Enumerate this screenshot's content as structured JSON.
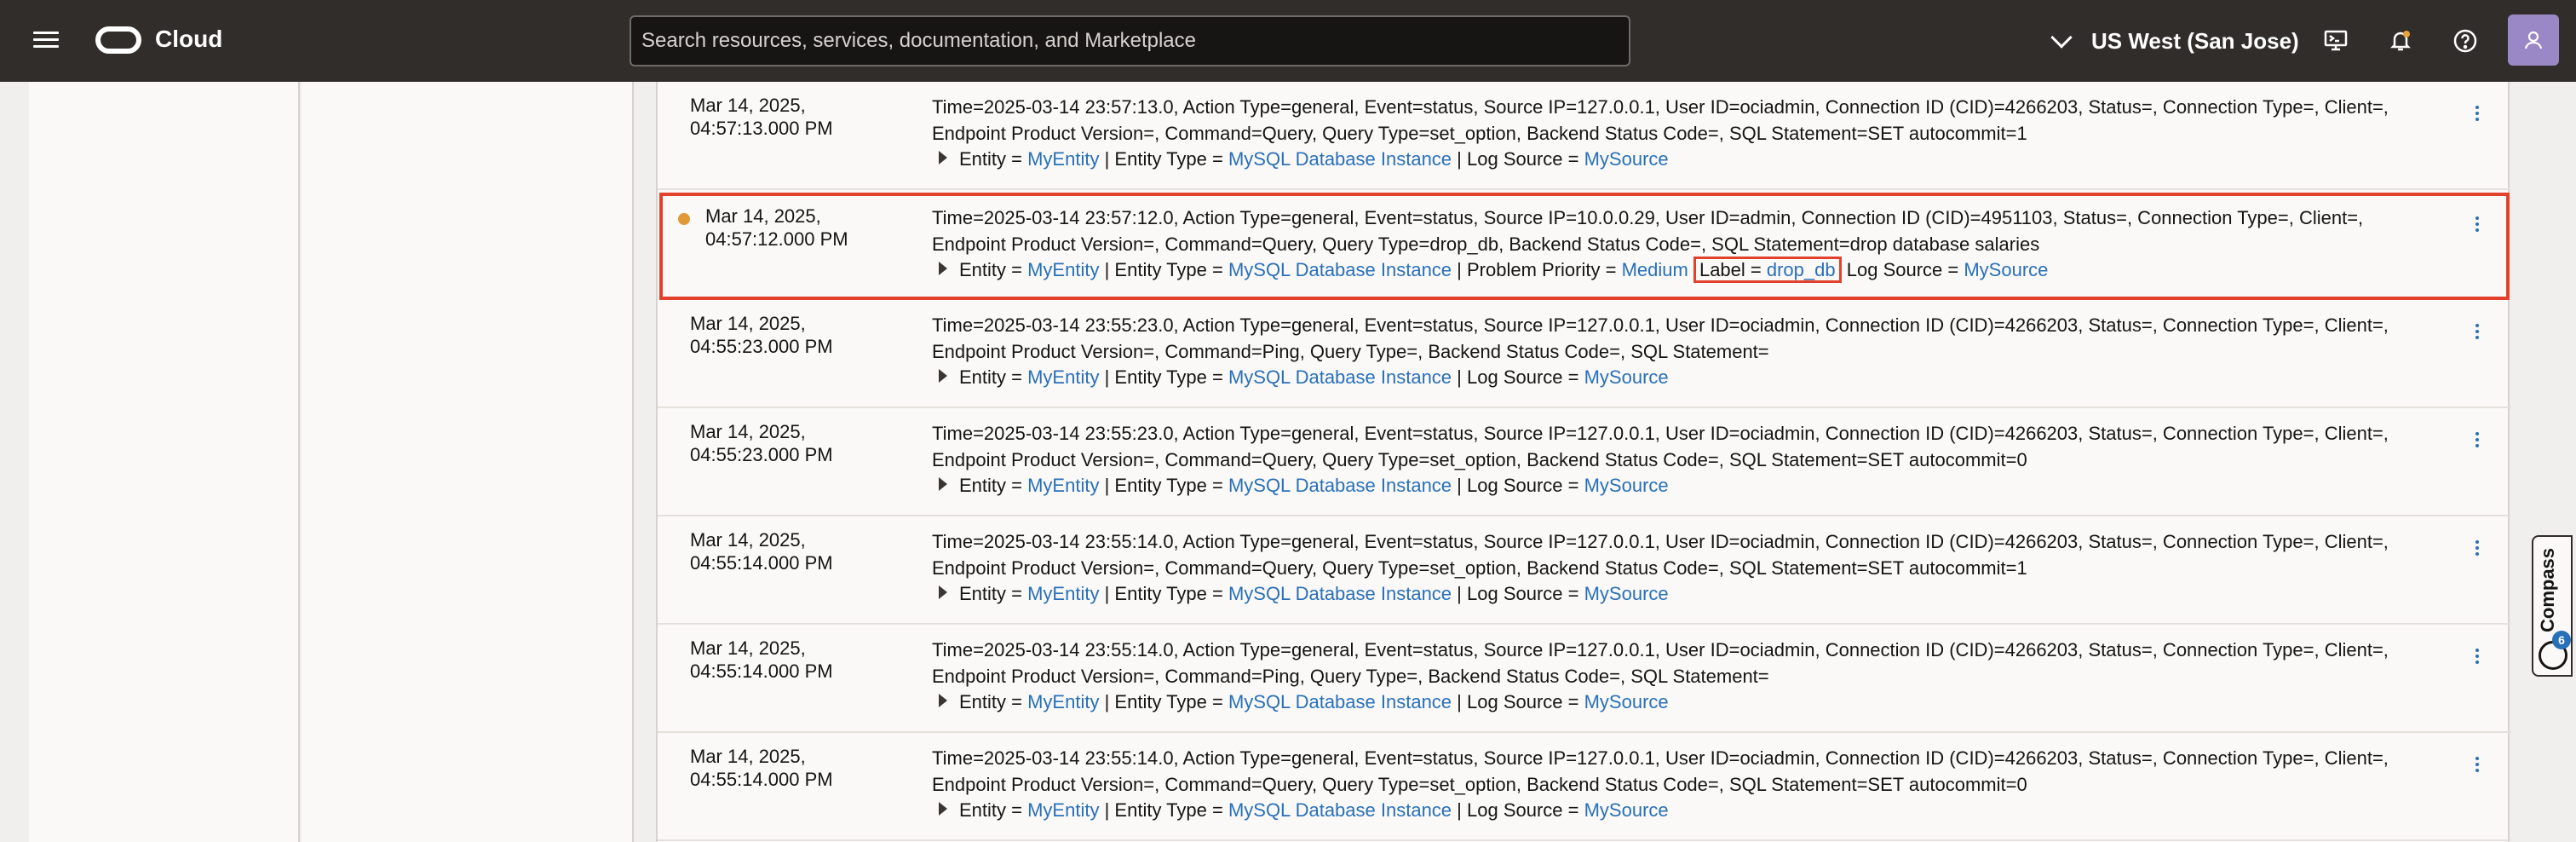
{
  "header": {
    "brand": "Cloud",
    "search_placeholder": "Search resources, services, documentation, and Marketplace",
    "region": "US West (San Jose)"
  },
  "compass": {
    "label": "Compass",
    "badge": "6"
  },
  "rows": [
    {
      "date": "Mar 14, 2025,",
      "time": "04:57:13.000 PM",
      "msg": "Time=2025-03-14 23:57:13.0, Action Type=general, Event=status, Source IP=127.0.0.1, User ID=ociadmin, Connection ID (CID)=4266203, Status=, Connection Type=, Client=, Endpoint Product Version=, Command=Query, Query Type=set_option, Backend Status Code=, SQL Statement=SET autocommit=1",
      "entity_key": "Entity =",
      "entity": "MyEntity",
      "sep1": "| Entity Type =",
      "entity_type": "MySQL Database Instance",
      "sep2": "| Log Source =",
      "log_source": "MySource"
    },
    {
      "date": "Mar 14, 2025,",
      "time": "04:57:12.000 PM",
      "msg": "Time=2025-03-14 23:57:12.0, Action Type=general, Event=status, Source IP=10.0.0.29, User ID=admin, Connection ID (CID)=4951103, Status=, Connection Type=, Client=, Endpoint Product Version=, Command=Query, Query Type=drop_db, Backend Status Code=, SQL Statement=drop database salaries",
      "entity_key": "Entity =",
      "entity": "MyEntity",
      "sep1": "| Entity Type =",
      "entity_type": "MySQL Database Instance",
      "priority_key": "| Problem Priority =",
      "priority": "Medium",
      "label_key": "Label =",
      "label": "drop_db",
      "sep2": "Log Source =",
      "log_source": "MySource"
    },
    {
      "date": "Mar 14, 2025,",
      "time": "04:55:23.000 PM",
      "msg": "Time=2025-03-14 23:55:23.0, Action Type=general, Event=status, Source IP=127.0.0.1, User ID=ociadmin, Connection ID (CID)=4266203, Status=, Connection Type=, Client=, Endpoint Product Version=, Command=Ping, Query Type=, Backend Status Code=, SQL Statement=",
      "entity_key": "Entity =",
      "entity": "MyEntity",
      "sep1": "| Entity Type =",
      "entity_type": "MySQL Database Instance",
      "sep2": "| Log Source =",
      "log_source": "MySource"
    },
    {
      "date": "Mar 14, 2025,",
      "time": "04:55:23.000 PM",
      "msg": "Time=2025-03-14 23:55:23.0, Action Type=general, Event=status, Source IP=127.0.0.1, User ID=ociadmin, Connection ID (CID)=4266203, Status=, Connection Type=, Client=, Endpoint Product Version=, Command=Query, Query Type=set_option, Backend Status Code=, SQL Statement=SET autocommit=0",
      "entity_key": "Entity =",
      "entity": "MyEntity",
      "sep1": "| Entity Type =",
      "entity_type": "MySQL Database Instance",
      "sep2": "| Log Source =",
      "log_source": "MySource"
    },
    {
      "date": "Mar 14, 2025,",
      "time": "04:55:14.000 PM",
      "msg": "Time=2025-03-14 23:55:14.0, Action Type=general, Event=status, Source IP=127.0.0.1, User ID=ociadmin, Connection ID (CID)=4266203, Status=, Connection Type=, Client=, Endpoint Product Version=, Command=Query, Query Type=set_option, Backend Status Code=, SQL Statement=SET autocommit=1",
      "entity_key": "Entity =",
      "entity": "MyEntity",
      "sep1": "| Entity Type =",
      "entity_type": "MySQL Database Instance",
      "sep2": "| Log Source =",
      "log_source": "MySource"
    },
    {
      "date": "Mar 14, 2025,",
      "time": "04:55:14.000 PM",
      "msg": "Time=2025-03-14 23:55:14.0, Action Type=general, Event=status, Source IP=127.0.0.1, User ID=ociadmin, Connection ID (CID)=4266203, Status=, Connection Type=, Client=, Endpoint Product Version=, Command=Ping, Query Type=, Backend Status Code=, SQL Statement=",
      "entity_key": "Entity =",
      "entity": "MyEntity",
      "sep1": "| Entity Type =",
      "entity_type": "MySQL Database Instance",
      "sep2": "| Log Source =",
      "log_source": "MySource"
    },
    {
      "date": "Mar 14, 2025,",
      "time": "04:55:14.000 PM",
      "msg": "Time=2025-03-14 23:55:14.0, Action Type=general, Event=status, Source IP=127.0.0.1, User ID=ociadmin, Connection ID (CID)=4266203, Status=, Connection Type=, Client=, Endpoint Product Version=, Command=Query, Query Type=set_option, Backend Status Code=, SQL Statement=SET autocommit=0",
      "entity_key": "Entity =",
      "entity": "MyEntity",
      "sep1": "| Entity Type =",
      "entity_type": "MySQL Database Instance",
      "sep2": "| Log Source =",
      "log_source": "MySource"
    }
  ]
}
